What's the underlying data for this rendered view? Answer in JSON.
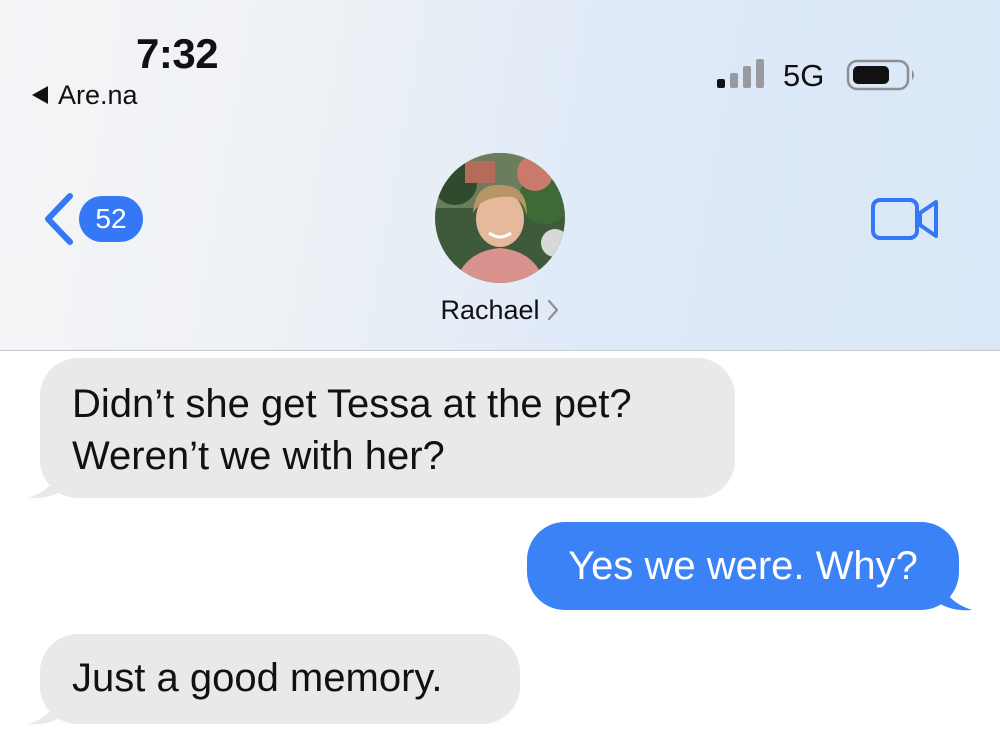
{
  "status_bar": {
    "time": "7:32",
    "back_app": "Are.na",
    "network": "5G",
    "signal_bars_active": 1,
    "signal_bars_total": 4
  },
  "nav": {
    "back_badge": "52",
    "contact_name": "Rachael",
    "accent_color": "#3478f6"
  },
  "messages": [
    {
      "direction": "incoming",
      "text": "Didn’t she get Tessa at the pet?\nWeren’t we with her?"
    },
    {
      "direction": "outgoing",
      "text": "Yes we were. Why?"
    },
    {
      "direction": "incoming",
      "text": "Just a good memory."
    }
  ],
  "icons": {
    "back": "chevron-left-icon",
    "video": "video-camera-icon",
    "contact_chevron": "chevron-right-icon"
  }
}
